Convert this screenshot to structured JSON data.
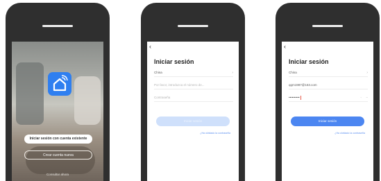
{
  "colors": {
    "accent": "#4c86f1",
    "accent_disabled": "#cfe0fb",
    "app_icon": "#2f7ff0"
  },
  "phone1": {
    "icon": "smart-home-app-icon",
    "login_existing": "Iniciar sesión con cuenta existente",
    "create_account": "Crear cuenta nueva",
    "try_now": "Consultar ahora"
  },
  "phone2": {
    "back_icon": "back-arrow-icon",
    "title": "Iniciar sesión",
    "country": "China",
    "account_placeholder": "Por favor, introduzca el número de...",
    "password_placeholder": "Contraseña",
    "login_button": "Iniciar sesión",
    "forgot": "¿Ha olvidado la contraseña"
  },
  "phone3": {
    "back_icon": "back-arrow-icon",
    "title": "Iniciar sesión",
    "country": "China",
    "account_value": "qqm1987@163.com",
    "password_value": "••••••••••",
    "login_button": "Iniciar sesión",
    "forgot": "¿Ha olvidado la contraseña"
  }
}
